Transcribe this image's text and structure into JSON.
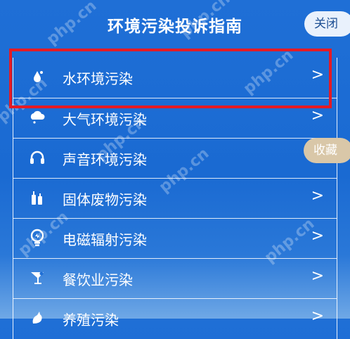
{
  "header": {
    "title": "环境污染投诉指南",
    "close_label": "关闭"
  },
  "favorite_label": "收藏",
  "items": [
    {
      "label": "水环境污染",
      "icon": "water-drop-icon",
      "chevron": ">"
    },
    {
      "label": "大气环境污染",
      "icon": "cloud-icon",
      "chevron": ">"
    },
    {
      "label": "声音环境污染",
      "icon": "headphones-icon",
      "chevron": ">"
    },
    {
      "label": "固体废物污染",
      "icon": "bottles-icon",
      "chevron": ">"
    },
    {
      "label": "电磁辐射污染",
      "icon": "lightbulb-icon",
      "chevron": ">"
    },
    {
      "label": "餐饮业污染",
      "icon": "cocktail-icon",
      "chevron": ">"
    },
    {
      "label": "养殖污染",
      "icon": "animal-icon",
      "chevron": ">"
    }
  ],
  "watermark_text": "php.cn",
  "colors": {
    "background": "#1f6fd6",
    "highlight_border": "#e51b24",
    "close_button_bg": "#e9f1fc",
    "favorite_button_bg": "#d9c7a8"
  }
}
